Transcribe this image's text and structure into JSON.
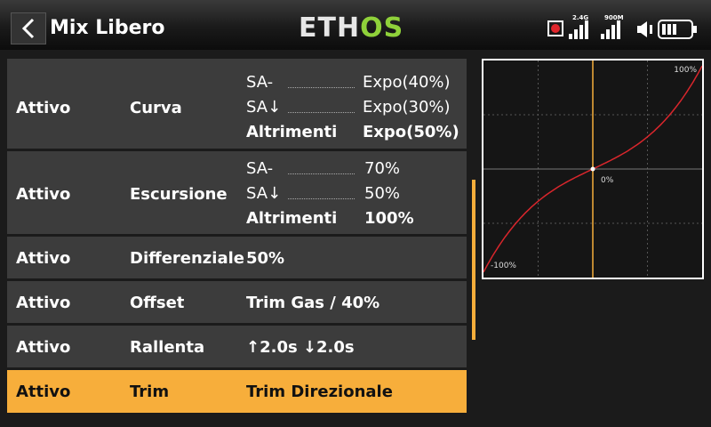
{
  "header": {
    "title": "Mix Libero",
    "logo_main": "ETH",
    "logo_accent": "OS",
    "signal1_label": "2.4G",
    "signal2_label": "900M"
  },
  "rows": [
    {
      "status": "Attivo",
      "name": "Curva",
      "subs": [
        {
          "key": "SA-",
          "value": "Expo(40%)"
        },
        {
          "key": "SA↓",
          "value": "Expo(30%)"
        },
        {
          "key": "Altrimenti",
          "value": "Expo(50%)"
        }
      ]
    },
    {
      "status": "Attivo",
      "name": "Escursione",
      "subs": [
        {
          "key": "SA-",
          "value": "70%"
        },
        {
          "key": "SA↓",
          "value": "50%"
        },
        {
          "key": "Altrimenti",
          "value": "100%"
        }
      ]
    },
    {
      "status": "Attivo",
      "name": "Differenziale",
      "value": "50%"
    },
    {
      "status": "Attivo",
      "name": "Offset",
      "value": "Trim Gas / 40%"
    },
    {
      "status": "Attivo",
      "name": "Rallenta",
      "value": "↑2.0s ↓2.0s"
    },
    {
      "status": "Attivo",
      "name": "Trim",
      "value": "Trim Direzionale",
      "selected": true
    }
  ],
  "graph": {
    "label_top": "100%",
    "label_center": "0%",
    "label_bottom": "-100%",
    "expo_percent": 50,
    "curve_color": "#d9262c",
    "cursor_color": "#f7ae3b"
  },
  "colors": {
    "accent": "#f7ae3b",
    "row_bg": "#3c3c3c",
    "logo_accent": "#8fd13a"
  }
}
